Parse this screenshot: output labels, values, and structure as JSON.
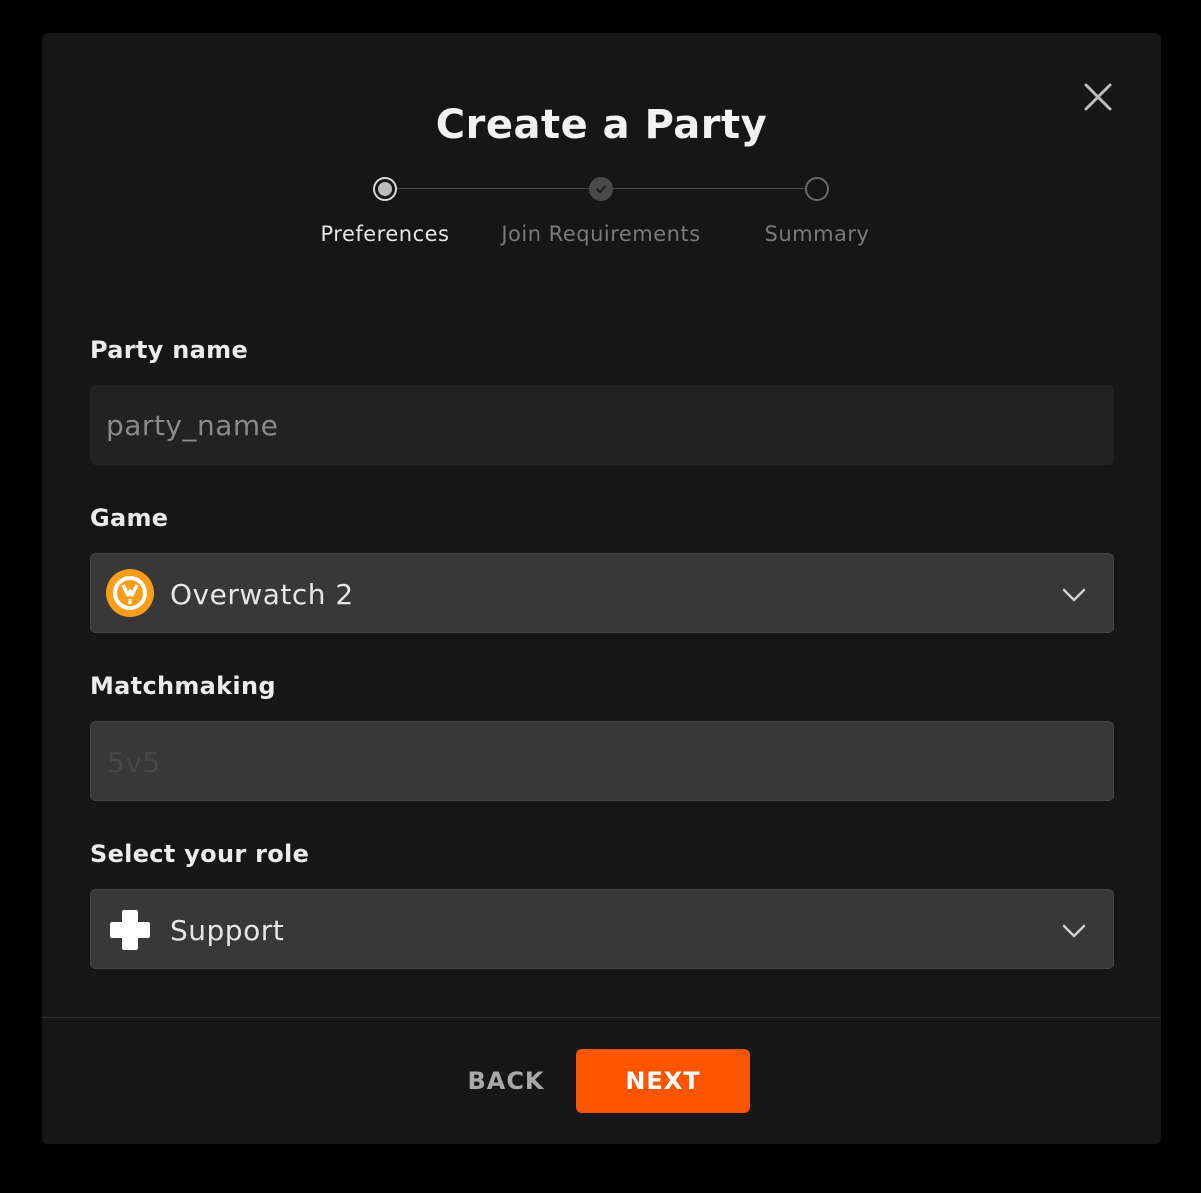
{
  "modal": {
    "title": "Create a Party",
    "close_icon": "close-icon"
  },
  "stepper": {
    "steps": [
      {
        "label": "Preferences",
        "state": "active"
      },
      {
        "label": "Join Requirements",
        "state": "done"
      },
      {
        "label": "Summary",
        "state": "pending"
      }
    ]
  },
  "form": {
    "party_name": {
      "label": "Party name",
      "placeholder": "party_name",
      "value": ""
    },
    "game": {
      "label": "Game",
      "value": "Overwatch 2",
      "icon": "overwatch-logo-icon"
    },
    "matchmaking": {
      "label": "Matchmaking",
      "placeholder": "5v5",
      "value": ""
    },
    "role": {
      "label": "Select your role",
      "value": "Support",
      "icon": "support-role-icon"
    }
  },
  "footer": {
    "back_label": "BACK",
    "next_label": "NEXT"
  },
  "colors": {
    "background": "#000000",
    "modal": "#161616",
    "accent": "#ff5500",
    "overwatch_orange": "#f99e1a"
  }
}
